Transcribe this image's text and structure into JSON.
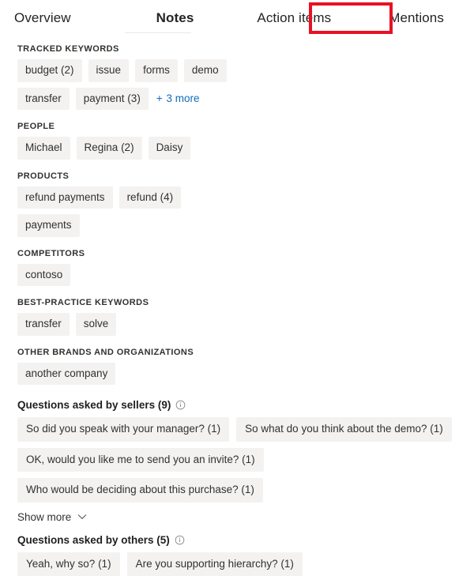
{
  "tabs": [
    {
      "label": "Overview",
      "selected": false
    },
    {
      "label": "Notes",
      "selected": true
    },
    {
      "label": "Action items",
      "selected": false
    },
    {
      "label": "Mentions",
      "selected": false,
      "highlighted": true
    }
  ],
  "annotation": {
    "color": "#e81123",
    "target": "Mentions"
  },
  "colors": {
    "chip_background": "#f3f2f1",
    "chip_text": "#323130",
    "link": "#0f6cbd",
    "heading": "#323130",
    "page_background": "#ffffff",
    "annotation_red": "#e81123"
  },
  "sections": [
    {
      "title": "TRACKED KEYWORDS",
      "chips": [
        "budget (2)",
        "issue",
        "forms",
        "demo",
        "transfer",
        "payment (3)"
      ],
      "more_link": {
        "plus": "+",
        "label": "3 more"
      }
    },
    {
      "title": "PEOPLE",
      "chips": [
        "Michael",
        "Regina (2)",
        "Daisy"
      ]
    },
    {
      "title": "PRODUCTS",
      "chips": [
        "refund payments",
        "refund (4)",
        "payments"
      ]
    },
    {
      "title": "COMPETITORS",
      "chips": [
        "contoso"
      ]
    },
    {
      "title": "BEST-PRACTICE KEYWORDS",
      "chips": [
        "transfer",
        "solve"
      ]
    },
    {
      "title": "OTHER BRANDS AND ORGANIZATIONS",
      "chips": [
        "another company"
      ]
    }
  ],
  "question_blocks": [
    {
      "heading": "Questions asked by sellers (9)",
      "info_icon": "info-circle-icon",
      "chips": [
        "So did you speak with your manager? (1)",
        "So what do you think about the demo? (1)",
        "OK, would you like me to send you an invite? (1)",
        "Who would be deciding about this purchase? (1)"
      ],
      "show_more": {
        "label": "Show more",
        "icon": "chevron-down-icon"
      }
    },
    {
      "heading": "Questions asked by others (5)",
      "info_icon": "info-circle-icon",
      "chips": [
        "Yeah, why so? (1)",
        "Are you supporting hierarchy? (1)"
      ]
    }
  ]
}
